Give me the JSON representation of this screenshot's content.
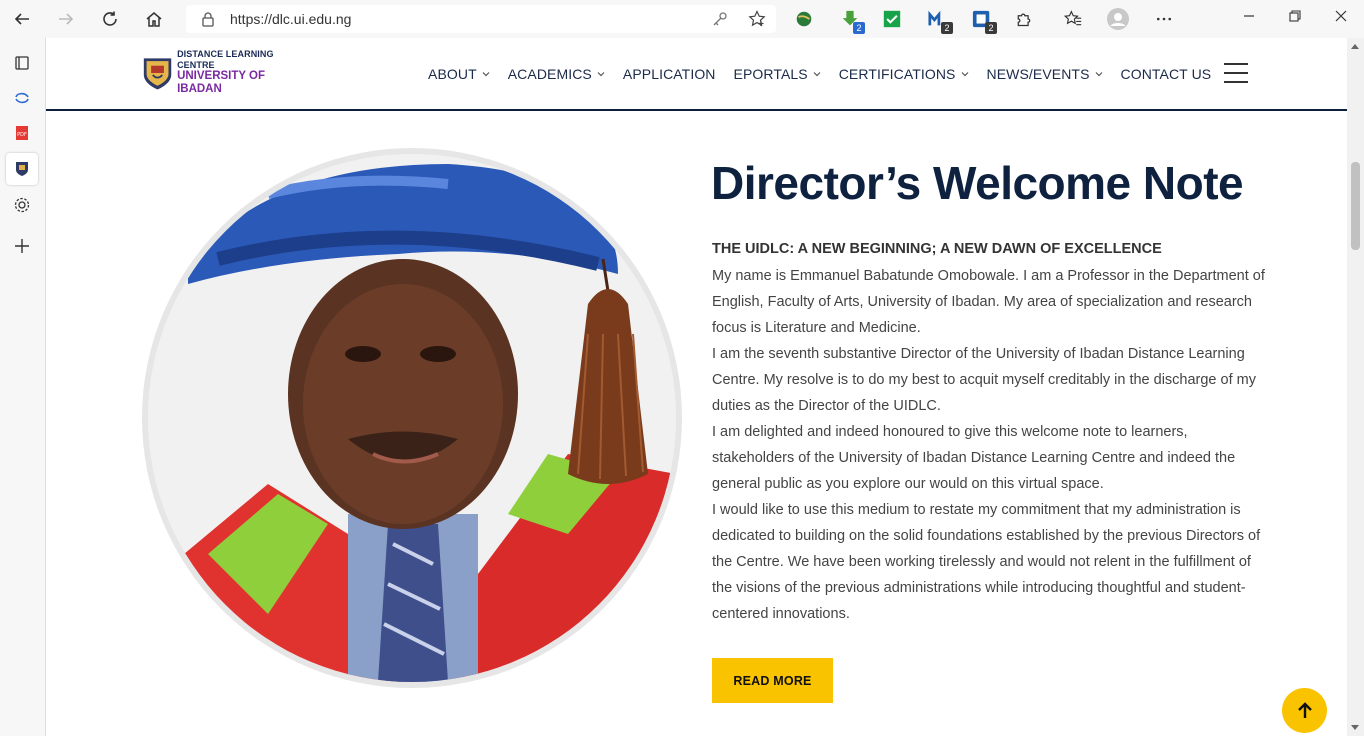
{
  "browser": {
    "url": "https://dlc.ui.edu.ng",
    "extension_badges": [
      "2",
      "2",
      "2"
    ]
  },
  "site": {
    "logo": {
      "line1": "DISTANCE LEARNING CENTRE",
      "line2": "UNIVERSITY OF IBADAN"
    },
    "nav": [
      {
        "label": "ABOUT",
        "dropdown": true
      },
      {
        "label": "ACADEMICS",
        "dropdown": true
      },
      {
        "label": "APPLICATION",
        "dropdown": false
      },
      {
        "label": "EPORTALS",
        "dropdown": true
      },
      {
        "label": "CERTIFICATIONS",
        "dropdown": true
      },
      {
        "label": "NEWS/EVENTS",
        "dropdown": true
      },
      {
        "label": "CONTACT US",
        "dropdown": false
      }
    ]
  },
  "welcome": {
    "title": "Director’s Welcome Note",
    "subtitle": "THE UIDLC: A NEW BEGINNING; A NEW DAWN OF EXCELLENCE",
    "paragraphs": [
      "My name is Emmanuel Babatunde Omobowale. I am a Professor in the Department of English, Faculty of Arts, University of Ibadan. My area of specialization and research focus is Literature and Medicine.",
      "I am the seventh substantive Director of the University of Ibadan Distance Learning Centre. My resolve is to do my best to acquit myself creditably in the discharge of my duties as the Director of the UIDLC.",
      "I am delighted and indeed honoured to give this welcome note to learners, stakeholders of the University of Ibadan Distance Learning Centre and indeed the general public as you explore our would on this virtual space.",
      "I would like to use this medium to restate my commitment that my administration is dedicated to building on the solid foundations established by the previous Directors of the Centre. We have been working tirelessly and would not relent in the fulfillment of the visions of the previous administrations while introducing thoughtful and student-centered innovations."
    ],
    "button": "READ MORE"
  },
  "colors": {
    "accent": "#f9c300",
    "navy": "#0e2240"
  }
}
